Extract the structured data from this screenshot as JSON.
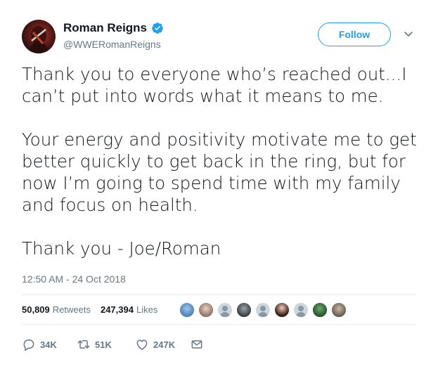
{
  "user": {
    "name": "Roman Reigns",
    "handle": "@WWERomanReigns"
  },
  "follow_label": "Follow",
  "tweet": {
    "paragraphs": [
      "Thank you to everyone who’s reached out...I can’t put into words what it means to me.",
      "Your energy and positivity motivate me to get better quickly to get back in the ring, but for now I’m going to spend time with my family and focus on health.",
      "Thank you - Joe/Roman"
    ],
    "timestamp": "12:50 AM - 24 Oct 2018"
  },
  "stats": {
    "retweets_count": "50,809",
    "retweets_label": "Retweets",
    "likes_count": "247,394",
    "likes_label": "Likes"
  },
  "actions": {
    "reply_count": "34K",
    "retweet_count": "51K",
    "like_count": "247K"
  },
  "colors": {
    "accent": "#1da1f2",
    "muted": "#657786",
    "text": "#14171a",
    "divider": "#e6ecf0"
  },
  "icons": [
    "verified-badge-icon",
    "chevron-down-icon",
    "reply-icon",
    "retweet-icon",
    "like-icon",
    "direct-message-icon"
  ]
}
